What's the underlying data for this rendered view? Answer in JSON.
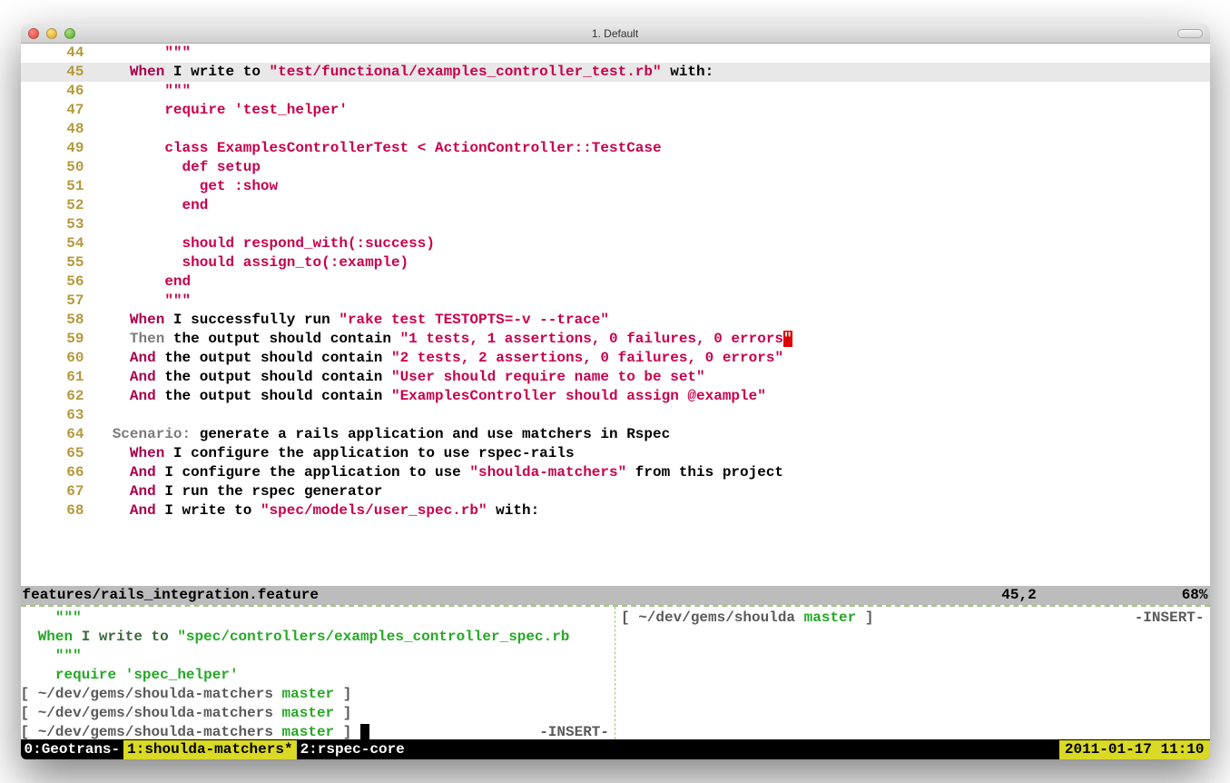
{
  "window": {
    "title": "1. Default"
  },
  "editor": {
    "lines": [
      {
        "n": 44,
        "indent": "        ",
        "parts": [
          {
            "t": "\"\"\"",
            "c": "str"
          }
        ]
      },
      {
        "n": 45,
        "hl": true,
        "indent": "    ",
        "parts": [
          {
            "t": "When",
            "c": "kw-when"
          },
          {
            "t": " I write to "
          },
          {
            "t": "\"test/functional/examples_controller_test.rb\"",
            "c": "str"
          },
          {
            "t": " with:"
          }
        ]
      },
      {
        "n": 46,
        "indent": "        ",
        "parts": [
          {
            "t": "\"\"\"",
            "c": "str"
          }
        ]
      },
      {
        "n": 47,
        "indent": "        ",
        "parts": [
          {
            "t": "require 'test_helper'",
            "c": "rb"
          }
        ]
      },
      {
        "n": 48,
        "indent": "",
        "parts": []
      },
      {
        "n": 49,
        "indent": "        ",
        "parts": [
          {
            "t": "class ExamplesControllerTest < ActionController::TestCase",
            "c": "rb"
          }
        ]
      },
      {
        "n": 50,
        "indent": "          ",
        "parts": [
          {
            "t": "def setup",
            "c": "rb"
          }
        ]
      },
      {
        "n": 51,
        "indent": "            ",
        "parts": [
          {
            "t": "get :show",
            "c": "rb"
          }
        ]
      },
      {
        "n": 52,
        "indent": "          ",
        "parts": [
          {
            "t": "end",
            "c": "rb"
          }
        ]
      },
      {
        "n": 53,
        "indent": "",
        "parts": []
      },
      {
        "n": 54,
        "indent": "          ",
        "parts": [
          {
            "t": "should respond_with(:success)",
            "c": "rb"
          }
        ]
      },
      {
        "n": 55,
        "indent": "          ",
        "parts": [
          {
            "t": "should assign_to(:example)",
            "c": "rb"
          }
        ]
      },
      {
        "n": 56,
        "indent": "        ",
        "parts": [
          {
            "t": "end",
            "c": "rb"
          }
        ]
      },
      {
        "n": 57,
        "indent": "        ",
        "parts": [
          {
            "t": "\"\"\"",
            "c": "str"
          }
        ]
      },
      {
        "n": 58,
        "indent": "    ",
        "parts": [
          {
            "t": "When",
            "c": "kw-when"
          },
          {
            "t": " I successfully run "
          },
          {
            "t": "\"rake test TESTOPTS=-v --trace\"",
            "c": "str"
          }
        ]
      },
      {
        "n": 59,
        "indent": "    ",
        "parts": [
          {
            "t": "Then",
            "c": "kw-then"
          },
          {
            "t": " the output should contain "
          },
          {
            "t": "\"1 tests, 1 assertions, 0 failures, 0 errors",
            "c": "str"
          },
          {
            "t": "\"",
            "c": "cursor"
          }
        ]
      },
      {
        "n": 60,
        "indent": "    ",
        "parts": [
          {
            "t": "And",
            "c": "kw-and"
          },
          {
            "t": " the output should contain "
          },
          {
            "t": "\"2 tests, 2 assertions, 0 failures, 0 errors\"",
            "c": "str"
          }
        ]
      },
      {
        "n": 61,
        "indent": "    ",
        "parts": [
          {
            "t": "And",
            "c": "kw-and"
          },
          {
            "t": " the output should contain "
          },
          {
            "t": "\"User should require name to be set\"",
            "c": "str"
          }
        ]
      },
      {
        "n": 62,
        "indent": "    ",
        "parts": [
          {
            "t": "And",
            "c": "kw-and"
          },
          {
            "t": " the output should contain "
          },
          {
            "t": "\"ExamplesController should assign @example\"",
            "c": "str"
          }
        ]
      },
      {
        "n": 63,
        "indent": "",
        "parts": []
      },
      {
        "n": 64,
        "indent": "  ",
        "parts": [
          {
            "t": "Scenario:",
            "c": "kw-scenario"
          },
          {
            "t": " generate a rails application and use matchers in Rspec"
          }
        ]
      },
      {
        "n": 65,
        "indent": "    ",
        "parts": [
          {
            "t": "When",
            "c": "kw-and"
          },
          {
            "t": " I configure the application to use rspec-rails"
          }
        ]
      },
      {
        "n": 66,
        "indent": "    ",
        "parts": [
          {
            "t": "And",
            "c": "kw-and"
          },
          {
            "t": " I configure the application to use "
          },
          {
            "t": "\"shoulda-matchers\"",
            "c": "str"
          },
          {
            "t": " from this project"
          }
        ]
      },
      {
        "n": 67,
        "indent": "    ",
        "parts": [
          {
            "t": "And",
            "c": "kw-and"
          },
          {
            "t": " I run the rspec generator"
          }
        ]
      },
      {
        "n": 68,
        "indent": "    ",
        "parts": [
          {
            "t": "And",
            "c": "kw-and"
          },
          {
            "t": " I write to "
          },
          {
            "t": "\"spec/models/user_spec.rb\"",
            "c": "str"
          },
          {
            "t": " with:"
          }
        ]
      }
    ]
  },
  "status": {
    "filename": "features/rails_integration.feature",
    "position": "45,2",
    "percent": "68%"
  },
  "lower_left": {
    "lines": [
      {
        "t": "    \"\"\"",
        "c": "g"
      },
      {
        "parts": [
          {
            "t": "  "
          },
          {
            "t": "When",
            "c": "g"
          },
          {
            "t": " I write to ",
            "c": "g-dark"
          },
          {
            "t": "\"spec/controllers/examples_controller_spec.rb",
            "c": "g"
          }
        ]
      },
      {
        "t": "    \"\"\"",
        "c": "g"
      },
      {
        "t": "    require 'spec_helper'",
        "c": "g"
      }
    ],
    "prompts": [
      {
        "path": "~/dev/gems/shoulda-matchers",
        "branch": "master"
      },
      {
        "path": "~/dev/gems/shoulda-matchers",
        "branch": "master"
      },
      {
        "path": "~/dev/gems/shoulda-matchers",
        "branch": "master",
        "cursor": true,
        "mode": "-INSERT-"
      }
    ]
  },
  "lower_right": {
    "prompt": {
      "path": "~/dev/gems/shoulda",
      "branch": "master",
      "mode": "-INSERT-"
    }
  },
  "tmux": {
    "tabs": [
      {
        "label": "0:Geotrans-",
        "active": false
      },
      {
        "label": "1:shoulda-matchers*",
        "active": true
      },
      {
        "label": "2:rspec-core",
        "active": false
      }
    ],
    "clock": "2011-01-17 11:10"
  }
}
